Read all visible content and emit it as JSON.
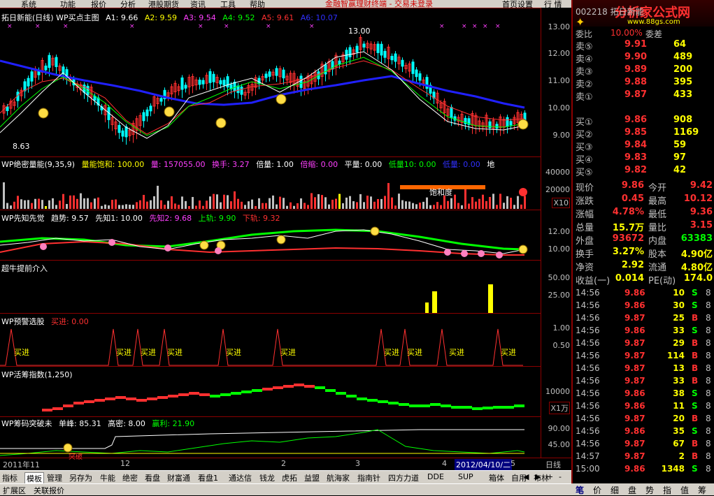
{
  "menu": {
    "items": [
      "系统",
      "功能",
      "报价",
      "分析",
      "港股期货",
      "资讯",
      "工具",
      "帮助"
    ],
    "vendor": "金融智赢理财终端 - 交易未登录",
    "right_items": [
      "首页设置",
      "行 情"
    ]
  },
  "main_panel": {
    "title": "拓日新能(日线) WP买点主图",
    "a1": "A1: 9.66",
    "a2": "A2: 9.59",
    "a3": "A3: 9.54",
    "a4": "A4: 9.52",
    "a5": "A5: 9.61",
    "a6": "A6: 10.07",
    "high_label": "13.00",
    "low_label": "8.63",
    "axis": [
      "13.00",
      "12.00",
      "11.00",
      "10.00",
      "9.00"
    ]
  },
  "volume_panel": {
    "title": "WP绝密量能(9,35,9)",
    "sat": "量能饱和: 100.00",
    "vol": "量: 157055.00",
    "turn": "换手: 3.27",
    "bei": "倍量: 1.00",
    "beisuo": "倍缩: 0.00",
    "ping": "平量: 0.00",
    "low10": "低量10: 0.00",
    "low": "低量: 0.00",
    "di": "地",
    "sat_label": "饱和度",
    "axis": [
      "40000",
      "20000"
    ],
    "unit": "X10"
  },
  "xianzhi_panel": {
    "title": "WP先知先觉",
    "trend": "趋势: 9.57",
    "x1": "先知1: 10.00",
    "x2": "先知2: 9.68",
    "up": "上轨: 9.90",
    "down": "下轨: 9.32",
    "axis": [
      "12.00",
      "10.00"
    ]
  },
  "chaoniu_panel": {
    "title": "超牛提前介入",
    "axis": [
      "50.00",
      "25.00"
    ]
  },
  "yujing_panel": {
    "title": "WP预警选股",
    "val": "买进: 0.00",
    "axis": [
      "1.00",
      "0.50"
    ],
    "buy_label": "买进"
  },
  "huochou_panel": {
    "title": "WP活筹指数(1,250)",
    "axis": [
      "10000"
    ],
    "unit": "X1万"
  },
  "chouma_panel": {
    "title": "WP筹码突破未",
    "danfeng": "单峰: 85.31",
    "gaomi": "高密: 8.00",
    "yingli": "赢利: 21.90",
    "axis": [
      "90.00",
      "45.00"
    ],
    "tupo": "突破"
  },
  "dates": {
    "d1": "2011年11",
    "d2": "12",
    "d3": "2",
    "d4": "3",
    "d5": "4",
    "d6": "2012/04/10/二",
    "d7": "5",
    "period": "日线"
  },
  "tabs": [
    "指标",
    "模板",
    "管理",
    "另存为",
    "牛能",
    "绝密",
    "看盘",
    "财富通",
    "看盘1",
    "通达信",
    "钱龙",
    "虎拓",
    "益盟",
    "航海家",
    "指南针",
    "四方力道",
    "DDE",
    "SUP",
    "箱体",
    "自用",
    "布林"
  ],
  "ext_label": "扩展区",
  "ext_label2": "关联报价",
  "logo": {
    "name": "分析家公式网",
    "url": "www.88gs.com",
    "stock": "002218 拓日新能"
  },
  "orderbook": {
    "top_label": "委比",
    "top_val": "10.00%",
    "top_label2": "委差",
    "sells": [
      [
        "卖⑤",
        "9.91",
        "64"
      ],
      [
        "卖④",
        "9.90",
        "489"
      ],
      [
        "卖③",
        "9.89",
        "200"
      ],
      [
        "卖②",
        "9.88",
        "395"
      ],
      [
        "卖①",
        "9.87",
        "433"
      ]
    ],
    "buys": [
      [
        "买①",
        "9.86",
        "908"
      ],
      [
        "买②",
        "9.85",
        "1169"
      ],
      [
        "买③",
        "9.84",
        "59"
      ],
      [
        "买④",
        "9.83",
        "97"
      ],
      [
        "买⑤",
        "9.82",
        "42"
      ]
    ]
  },
  "quote": [
    [
      "现价",
      "9.86",
      "今开",
      "9.42"
    ],
    [
      "涨跌",
      "0.45",
      "最高",
      "10.12"
    ],
    [
      "涨幅",
      "4.78%",
      "最低",
      "9.36"
    ],
    [
      "总量",
      "15.7万",
      "量比",
      "3.15"
    ],
    [
      "外盘",
      "93672",
      "内盘",
      "63383"
    ],
    [
      "换手",
      "3.27%",
      "股本",
      "4.90亿"
    ],
    [
      "净资",
      "2.92",
      "流通",
      "4.80亿"
    ],
    [
      "收益(一)",
      "0.014",
      "PE(动)",
      "174.0"
    ]
  ],
  "ticks": [
    [
      "14:56",
      "9.86",
      "10",
      "S"
    ],
    [
      "14:56",
      "9.86",
      "30",
      "S"
    ],
    [
      "14:56",
      "9.87",
      "25",
      "B"
    ],
    [
      "14:56",
      "9.86",
      "33",
      "S"
    ],
    [
      "14:56",
      "9.87",
      "29",
      "B"
    ],
    [
      "14:56",
      "9.87",
      "114",
      "B"
    ],
    [
      "14:56",
      "9.87",
      "13",
      "B"
    ],
    [
      "14:56",
      "9.87",
      "33",
      "B"
    ],
    [
      "14:56",
      "9.86",
      "38",
      "S"
    ],
    [
      "14:56",
      "9.86",
      "11",
      "S"
    ],
    [
      "14:56",
      "9.87",
      "20",
      "B"
    ],
    [
      "14:56",
      "9.86",
      "35",
      "S"
    ],
    [
      "14:56",
      "9.87",
      "67",
      "B"
    ],
    [
      "14:57",
      "9.87",
      "2",
      "B"
    ],
    [
      "15:00",
      "9.86",
      "1348",
      "S"
    ]
  ],
  "tick_extra": [
    "8",
    "8",
    "8",
    "8",
    "8",
    "8",
    "8",
    "8",
    "8",
    "8",
    "8",
    "8",
    "8",
    "8",
    "8"
  ],
  "bottom_tabs": [
    "笔",
    "价",
    "细",
    "盘",
    "势",
    "指",
    "值",
    "筹"
  ],
  "colors": {
    "red": "#ff3030",
    "green": "#00ff00",
    "yellow": "#ffff00",
    "blue": "#3030ff",
    "cyan": "#00ffff",
    "magenta": "#ff40ff",
    "white": "#ffffff",
    "darkred": "#8b0000",
    "orange": "#ff6600"
  }
}
